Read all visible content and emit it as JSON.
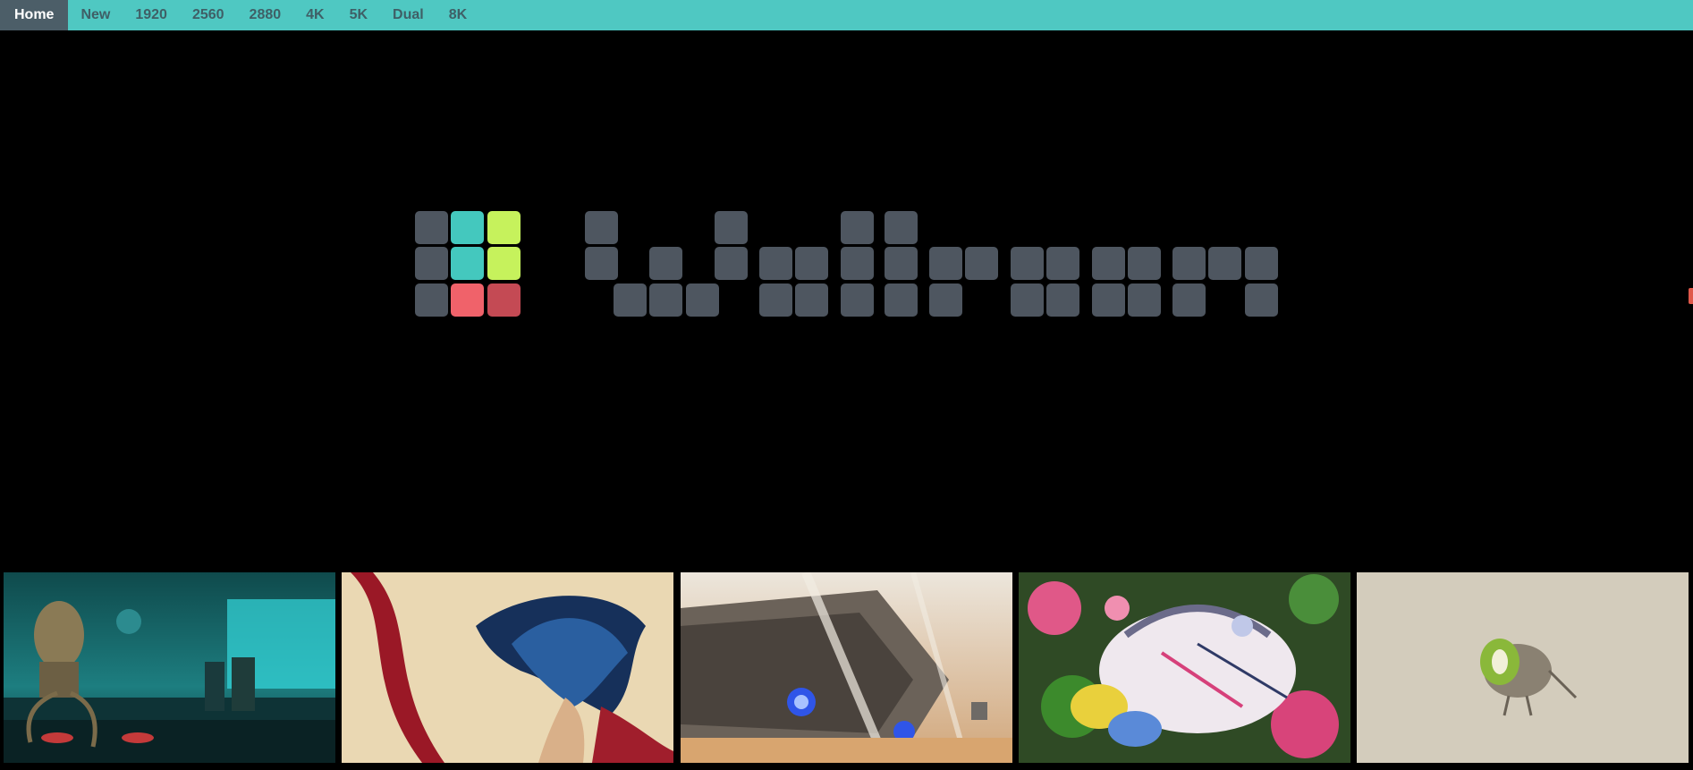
{
  "nav": {
    "items": [
      {
        "label": "Home",
        "active": true
      },
      {
        "label": "New"
      },
      {
        "label": "1920"
      },
      {
        "label": "2560"
      },
      {
        "label": "2880"
      },
      {
        "label": "4K"
      },
      {
        "label": "5K"
      },
      {
        "label": "Dual"
      },
      {
        "label": "8K"
      }
    ]
  },
  "colors": {
    "nav_bar": "#4fc8c2",
    "nav_active": "#4c5e68",
    "logo_block": "#4e5660",
    "logo_teal": "#44c8be",
    "logo_lime": "#c6f25c",
    "logo_red": "#f0626a",
    "logo_dark_red": "#c44a54"
  },
  "logo": {
    "icon": "wallhaven-logo"
  },
  "thumbnails": [
    {
      "icon": "steampunk-octopus-bar-wallpaper"
    },
    {
      "icon": "blue-hair-girl-red-ribbon-wallpaper"
    },
    {
      "icon": "desert-crashed-starship-wallpaper"
    },
    {
      "icon": "colorful-anime-floral-wallpaper"
    },
    {
      "icon": "kiwi-bird-sketch-wallpaper"
    }
  ]
}
